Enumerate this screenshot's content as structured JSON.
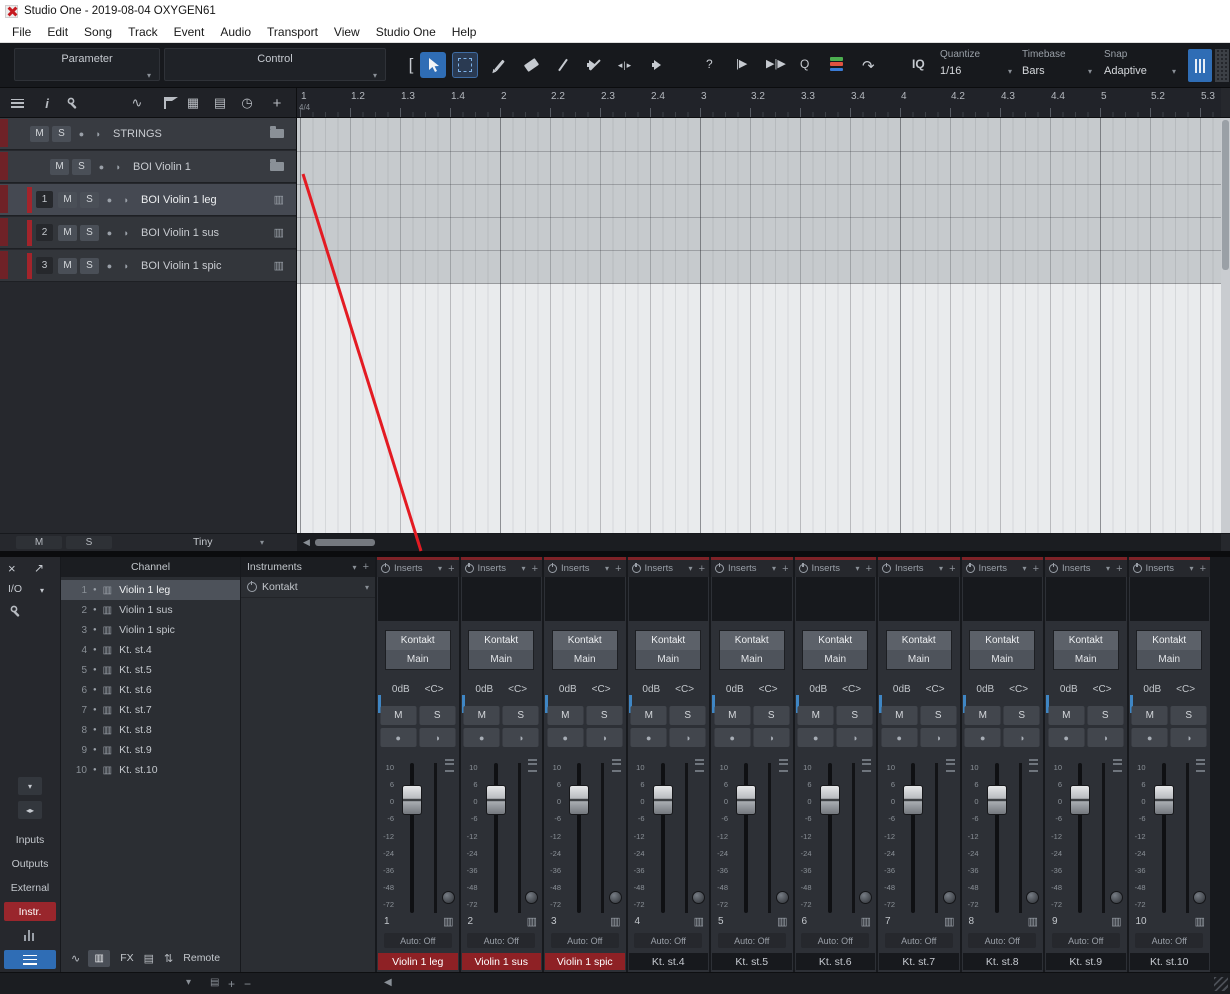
{
  "window": {
    "title": "Studio One - 2019-08-04 OXYGEN61"
  },
  "menubar": {
    "items": [
      "File",
      "Edit",
      "Song",
      "Track",
      "Event",
      "Audio",
      "Transport",
      "View",
      "Studio One",
      "Help"
    ]
  },
  "toolbar": {
    "parameter_label": "Parameter",
    "control_label": "Control",
    "help_label": "?",
    "q_label": "Q",
    "iq_label": "IQ",
    "quantize_label": "Quantize",
    "quantize_value": "1/16",
    "timebase_label": "Timebase",
    "timebase_value": "Bars",
    "snap_label": "Snap",
    "snap_value": "Adaptive"
  },
  "ruler": {
    "time_signature": "4/4",
    "ticks": [
      "1",
      "1.2",
      "1.3",
      "1.4",
      "2",
      "2.2",
      "2.3",
      "2.4",
      "3",
      "3.2",
      "3.3",
      "3.4",
      "4",
      "4.2",
      "4.3",
      "4.4",
      "5",
      "5.2",
      "5.3"
    ]
  },
  "arrange": {
    "folders": [
      {
        "name": "STRINGS"
      },
      {
        "name": "BOI Violin 1"
      }
    ],
    "tracks": [
      {
        "num": "1",
        "name": "BOI Violin 1 leg",
        "selected": true
      },
      {
        "num": "2",
        "name": "BOI Violin 1 sus",
        "selected": false
      },
      {
        "num": "3",
        "name": "BOI Violin 1 spic",
        "selected": false
      }
    ],
    "mute_label": "M",
    "solo_label": "S",
    "track_size": "Tiny"
  },
  "console": {
    "io_label": "I/O",
    "channel_header": "Channel",
    "channels": [
      {
        "num": "1",
        "name": "Violin 1 leg",
        "selected": true
      },
      {
        "num": "2",
        "name": "Violin 1 sus",
        "selected": false
      },
      {
        "num": "3",
        "name": "Violin 1 spic",
        "selected": false
      },
      {
        "num": "4",
        "name": "Kt. st.4",
        "selected": false
      },
      {
        "num": "5",
        "name": "Kt. st.5",
        "selected": false
      },
      {
        "num": "6",
        "name": "Kt. st.6",
        "selected": false
      },
      {
        "num": "7",
        "name": "Kt. st.7",
        "selected": false
      },
      {
        "num": "8",
        "name": "Kt. st.8",
        "selected": false
      },
      {
        "num": "9",
        "name": "Kt. st.9",
        "selected": false
      },
      {
        "num": "10",
        "name": "Kt. st.10",
        "selected": false
      }
    ],
    "nav": [
      {
        "label": "Inputs",
        "active": false
      },
      {
        "label": "Outputs",
        "active": false
      },
      {
        "label": "External",
        "active": false
      },
      {
        "label": "Instr.",
        "active": true
      }
    ],
    "footer": {
      "fx_label": "FX",
      "remote_label": "Remote"
    },
    "instruments": {
      "header": "Instruments",
      "device": "Kontakt"
    },
    "strip_defaults": {
      "inserts_label": "Inserts",
      "device": "Kontakt",
      "output": "Main",
      "gain": "0dB",
      "pan": "<C>",
      "mute_label": "M",
      "solo_label": "S",
      "auto_label": "Auto: Off",
      "fader_scale": [
        "10",
        "6",
        "0",
        "-6",
        "-12",
        "-24",
        "-36",
        "-48",
        "-72"
      ]
    },
    "strips": [
      {
        "num": "1",
        "name": "Violin 1 leg",
        "red": true
      },
      {
        "num": "2",
        "name": "Violin 1 sus",
        "red": true
      },
      {
        "num": "3",
        "name": "Violin 1 spic",
        "red": true
      },
      {
        "num": "4",
        "name": "Kt. st.4",
        "red": false
      },
      {
        "num": "5",
        "name": "Kt. st.5",
        "red": false
      },
      {
        "num": "6",
        "name": "Kt. st.6",
        "red": false
      },
      {
        "num": "7",
        "name": "Kt. st.7",
        "red": false
      },
      {
        "num": "8",
        "name": "Kt. st.8",
        "red": false
      },
      {
        "num": "9",
        "name": "Kt. st.9",
        "red": false
      },
      {
        "num": "10",
        "name": "Kt. st.10",
        "red": false
      }
    ]
  },
  "colors": {
    "accent_blue": "#2f6db5",
    "selection_red": "#8e2125",
    "annotation": "#e31b23"
  }
}
